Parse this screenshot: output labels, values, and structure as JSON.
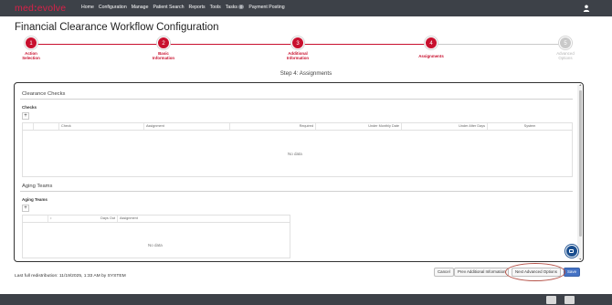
{
  "app": {
    "logo_left": "med",
    "logo_sep": ":",
    "logo_right": "evolve"
  },
  "nav": {
    "items": [
      "Home",
      "Configuration",
      "Manage",
      "Patient Search",
      "Reports",
      "Tools"
    ],
    "tasks_label": "Tasks",
    "tasks_count": "0",
    "payment_posting": "Payment Posting"
  },
  "page": {
    "title": "Financial Clearance Workflow Configuration",
    "step_heading": "Step 4: Assignments"
  },
  "stepper": {
    "steps": [
      {
        "number": "1",
        "label_line1": "Action",
        "label_line2": "Selection",
        "state": "complete"
      },
      {
        "number": "2",
        "label_line1": "Basic",
        "label_line2": "Information",
        "state": "complete"
      },
      {
        "number": "3",
        "label_line1": "Additional",
        "label_line2": "Information",
        "state": "complete"
      },
      {
        "number": "4",
        "label_line1": "Assignments",
        "label_line2": "",
        "state": "current"
      },
      {
        "number": "5",
        "label_line1": "Advanced",
        "label_line2": "Options",
        "state": "inactive"
      }
    ],
    "active_color": "#c8102e",
    "inactive_color": "#c9c9c9"
  },
  "clearance_checks": {
    "section_title": "Clearance Checks",
    "sub_title": "Checks",
    "add_label": "+",
    "columns": [
      "Check",
      "Assignment",
      "Required",
      "Under Monthly Date",
      "Under After Days",
      "System"
    ],
    "empty_text": "No data"
  },
  "aging_teams": {
    "section_title": "Aging Teams",
    "sub_title": "Aging Teams",
    "add_label": "+",
    "columns": [
      "Days Out",
      "Assignment"
    ],
    "empty_text": "No data"
  },
  "footer": {
    "last_redistribution": "Last full redistribution: 11/19/2025, 1:33 AM by SYSTEM",
    "cancel_label": "Cancel",
    "prev_label": "Prev Additional Information",
    "next_label": "Next Advanced Options",
    "save_label": "Save"
  },
  "colors": {
    "topbar": "#3d4148",
    "brand": "#d92148",
    "primary_button": "#4472c4"
  }
}
